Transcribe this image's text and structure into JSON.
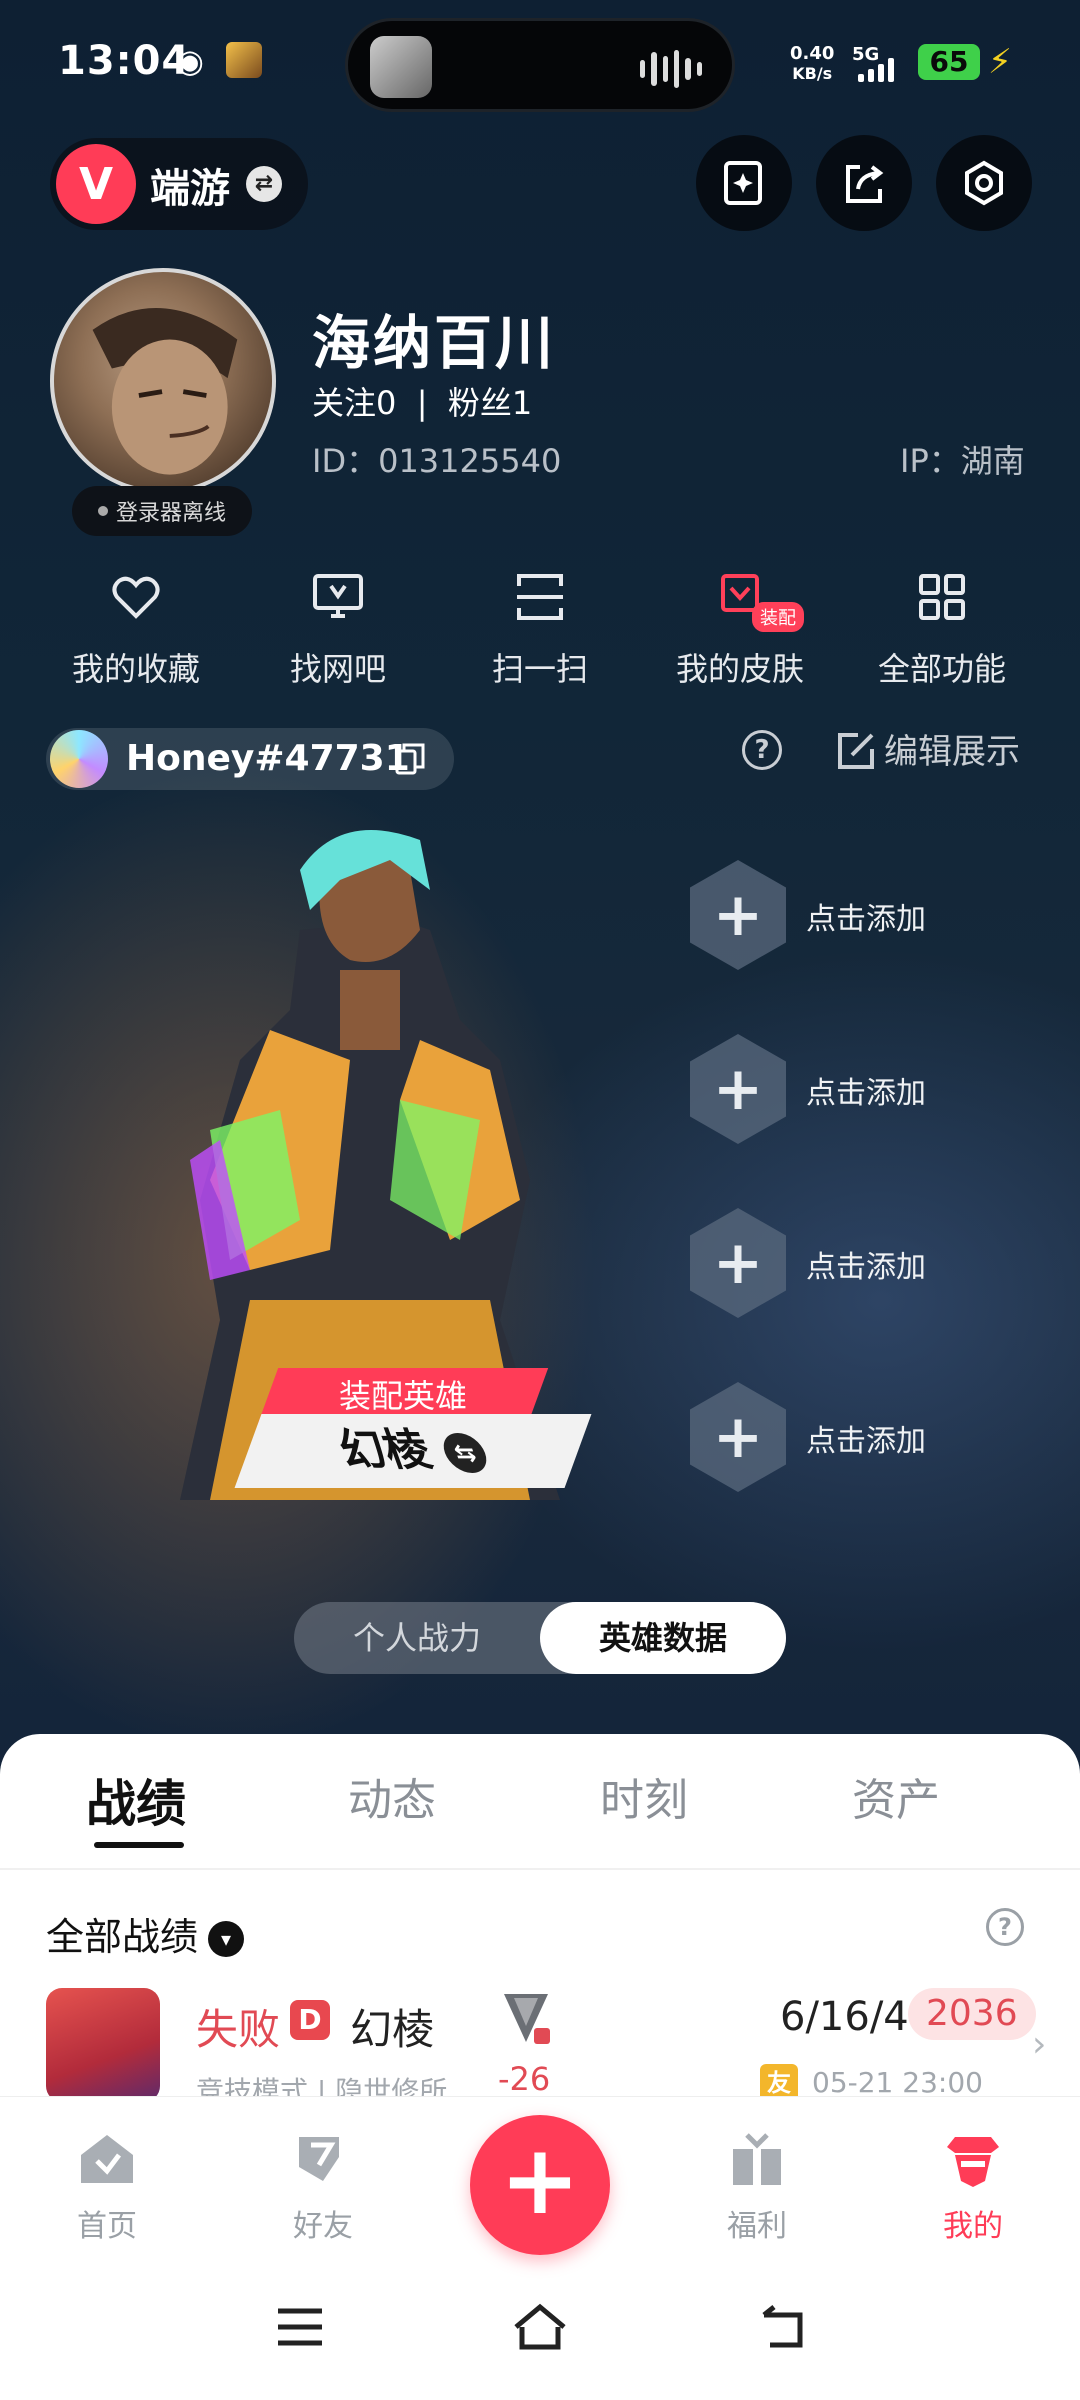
{
  "status_bar": {
    "time": "13:04",
    "net_speed_top": "0.40",
    "net_speed_unit": "KB/s",
    "network": "5G",
    "battery": "65"
  },
  "header": {
    "game_name": "端游",
    "game_logo": "V",
    "swap_icon": "⇄",
    "buttons": [
      "note-add-icon",
      "share-icon",
      "settings-icon"
    ]
  },
  "profile": {
    "nickname": "海纳百川",
    "follow_text": "关注0  |  粉丝1",
    "id_text": "ID：013125540",
    "ip_text": "IP：湖南",
    "status": "登录器离线"
  },
  "quick_menu": [
    {
      "label": "我的收藏",
      "icon": "heart-icon"
    },
    {
      "label": "找网吧",
      "icon": "monitor-icon"
    },
    {
      "label": "扫一扫",
      "icon": "scan-icon"
    },
    {
      "label": "我的皮肤",
      "icon": "skin-icon",
      "badge": "装配"
    },
    {
      "label": "全部功能",
      "icon": "grid-icon"
    }
  ],
  "riot": {
    "riot_id": "Honey#47731",
    "help": "?",
    "edit_label": "编辑展示"
  },
  "showcase": {
    "equip_tag": "装配英雄",
    "agent": "幻棱",
    "swap": "⇆",
    "slots": [
      "点击添加",
      "点击添加",
      "点击添加",
      "点击添加"
    ]
  },
  "toggle": {
    "left": "个人战力",
    "right": "英雄数据"
  },
  "tabs": [
    "战绩",
    "动态",
    "时刻",
    "资产"
  ],
  "records": {
    "filter_label": "全部战绩",
    "help": "?",
    "match": {
      "result": "失败",
      "rank_letter": "D",
      "agent": "幻棱",
      "mode": "竞技模式 | 隐世修所",
      "rr": "-26",
      "kda": "6/16/4",
      "acs": "2036",
      "badge": "友",
      "datetime": "05-21 23:00"
    }
  },
  "bottom_nav": [
    {
      "label": "首页",
      "icon": "home-icon"
    },
    {
      "label": "好友",
      "icon": "friends-icon"
    },
    {
      "label": "福利",
      "icon": "gift-icon"
    },
    {
      "label": "我的",
      "icon": "profile-icon",
      "active": true
    }
  ],
  "fab": "+",
  "colors": {
    "accent": "#ff3c57",
    "loss": "#e14a54",
    "bg_dark": "#0e2033"
  }
}
